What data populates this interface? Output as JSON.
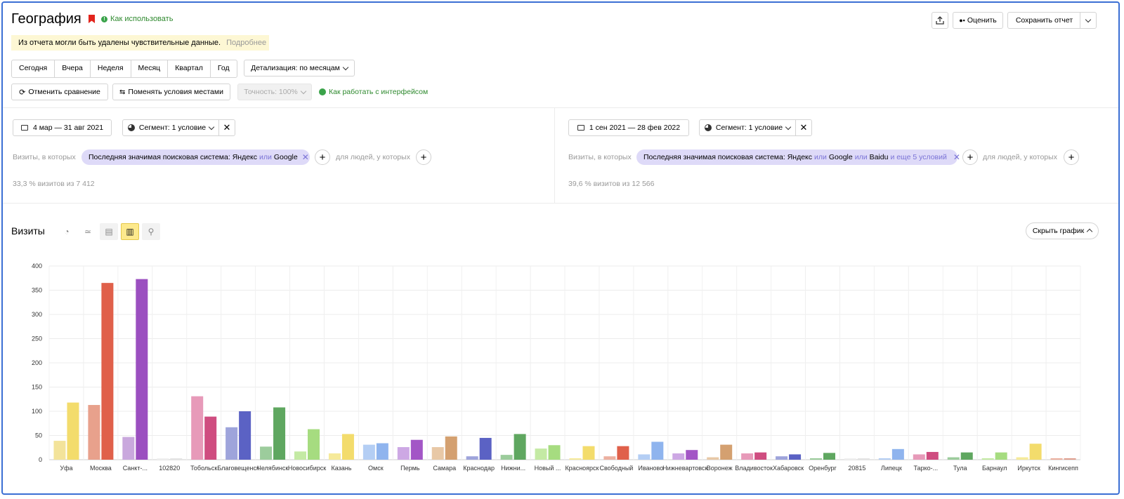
{
  "header": {
    "title": "География",
    "howto_link": "Как использовать",
    "warning_text": "Из отчета могли быть удалены чувствительные данные.",
    "warning_more": "Подробнее",
    "rate_label": "Оценить",
    "save_label": "Сохранить отчет"
  },
  "period_buttons": [
    "Сегодня",
    "Вчера",
    "Неделя",
    "Месяц",
    "Квартал",
    "Год"
  ],
  "detail_select": "Детализация: по месяцам",
  "toolbar": {
    "cancel_compare": "Отменить сравнение",
    "swap_conditions": "Поменять условия местами",
    "accuracy": "Точность: 100%",
    "interface_link": "Как работать с интерфейсом"
  },
  "segment_a": {
    "date_range": "4 мар — 31 авг 2021",
    "segment_label": "Сегмент: 1 условие",
    "visits_prefix": "Визиты, в которых",
    "chip_text": "Последняя значимая поисковая система: Яндекс",
    "chip_or": "или",
    "chip_text2": "Google",
    "people_label": "для людей, у которых",
    "stats": "33,3 % визитов из 7 412"
  },
  "segment_b": {
    "date_range": "1 сен 2021 — 28 фев 2022",
    "segment_label": "Сегмент: 1 условие",
    "visits_prefix": "Визиты, в которых",
    "chip_text": "Последняя значимая поисковая система: Яндекс",
    "chip_or": "или",
    "chip_text2": "Google",
    "chip_or2": "или",
    "chip_text3": "Baidu",
    "chip_more": "и еще 5 условий",
    "people_label": "для людей, у которых",
    "stats": "39,6 % визитов из 12 566"
  },
  "chart_header": {
    "title": "Визиты",
    "hide_graph": "Скрыть график"
  },
  "chart_data": {
    "type": "bar",
    "ylim": [
      0,
      400
    ],
    "yticks": [
      0,
      50,
      100,
      150,
      200,
      250,
      300,
      350,
      400
    ],
    "grid": true,
    "categories": [
      "Уфа",
      "Москва",
      "Санкт-...",
      "102820",
      "Тобольск",
      "Благовещенск",
      "Челябинск",
      "Новосибирск",
      "Казань",
      "Омск",
      "Пермь",
      "Самара",
      "Краснодар",
      "Нижни...",
      "Новый ...",
      "Красноярск",
      "Свободный",
      "Иваново",
      "Нижневартовск",
      "Воронеж",
      "Владивосток",
      "Хабаровск",
      "Оренбург",
      "20815",
      "Липецк",
      "Тарко-...",
      "Тула",
      "Барнаул",
      "Иркутск",
      "Кингисепп"
    ],
    "series_a_values": [
      39,
      113,
      47,
      3,
      131,
      67,
      27,
      17,
      13,
      31,
      26,
      26,
      7,
      10,
      23,
      3,
      7,
      11,
      13,
      5,
      13,
      7,
      3,
      3,
      3,
      11,
      5,
      3,
      5,
      3
    ],
    "series_b_values": [
      118,
      365,
      373,
      3,
      89,
      100,
      108,
      63,
      53,
      34,
      41,
      48,
      45,
      53,
      30,
      28,
      28,
      37,
      20,
      31,
      15,
      11,
      14,
      3,
      22,
      16,
      15,
      15,
      33,
      3
    ],
    "colors_a": [
      "#f3e39a",
      "#e8a18c",
      "#c9a8dd",
      "#f0f0f0",
      "#e79ab9",
      "#9ea4db",
      "#9ccc9c",
      "#c4eaa4",
      "#f6ea9a",
      "#b4cef4",
      "#cda8e4",
      "#e8c8a6",
      "#9ea4db",
      "#9ccc9c",
      "#c4eaa4",
      "#f6ea9a",
      "#ecb0a0",
      "#b4cef4",
      "#cda8e4",
      "#e8c8a6",
      "#e79ab9",
      "#9ea4db",
      "#9ccc9c",
      "#f0f0f0",
      "#b4cef4",
      "#e79ab9",
      "#9ccc9c",
      "#c4eaa4",
      "#f6ea9a",
      "#ecb0a0"
    ],
    "colors_b": [
      "#f3dc6c",
      "#e0604a",
      "#9b4fc0",
      "#e4e4e4",
      "#cf4d80",
      "#5b62c4",
      "#5fa760",
      "#a6dc80",
      "#f3dc6c",
      "#8fb4ee",
      "#a356c6",
      "#d4a070",
      "#5b62c4",
      "#5fa760",
      "#a6dc80",
      "#f3dc6c",
      "#e0604a",
      "#8fb4ee",
      "#a356c6",
      "#d4a070",
      "#cf4d80",
      "#5b62c4",
      "#5fa760",
      "#e4e4e4",
      "#8fb4ee",
      "#cf4d80",
      "#5fa760",
      "#a6dc80",
      "#f3dc6c",
      "#e0a090"
    ]
  }
}
